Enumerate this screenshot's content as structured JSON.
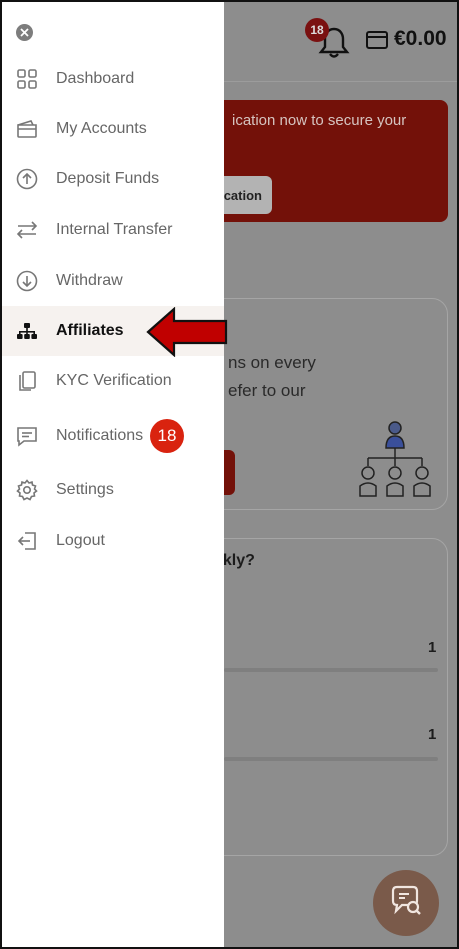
{
  "header": {
    "notification_count": "18",
    "balance": "€0.00"
  },
  "alert": {
    "text": "ication now to secure your",
    "button_label": "cation"
  },
  "affiliate_card": {
    "line1": "ns on every",
    "line2": "efer to our"
  },
  "stats_card": {
    "title": "ekly?",
    "values": [
      "1",
      "1"
    ]
  },
  "drawer": {
    "items": [
      {
        "label": "Dashboard",
        "icon": "grid-icon"
      },
      {
        "label": "My Accounts",
        "icon": "wallet-icon"
      },
      {
        "label": "Deposit Funds",
        "icon": "arrow-up-circle-icon"
      },
      {
        "label": "Internal Transfer",
        "icon": "transfer-arrows-icon"
      },
      {
        "label": "Withdraw",
        "icon": "arrow-down-circle-icon"
      },
      {
        "label": "Affiliates",
        "icon": "hierarchy-icon",
        "active": true
      },
      {
        "label": "KYC Verification",
        "icon": "documents-icon"
      },
      {
        "label": "Notifications",
        "icon": "message-icon",
        "badge": "18"
      },
      {
        "label": "Settings",
        "icon": "gear-icon"
      },
      {
        "label": "Logout",
        "icon": "logout-icon"
      }
    ]
  },
  "colors": {
    "accent_red": "#d9230f",
    "annotation_arrow": "#c00000",
    "active_bg": "#f6f2ef"
  }
}
